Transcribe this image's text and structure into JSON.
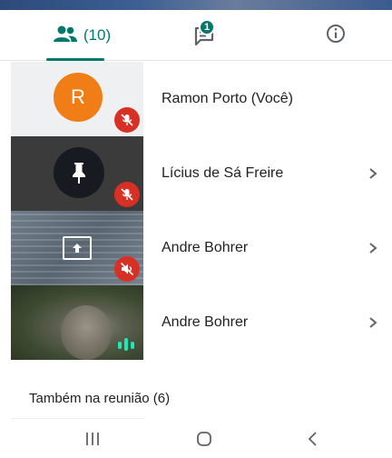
{
  "tabs": {
    "people": {
      "icon": "people-icon",
      "count": "(10)"
    },
    "chat": {
      "icon": "chat-icon",
      "badge": "1"
    },
    "info": {
      "icon": "info-icon"
    }
  },
  "colors": {
    "accent": "#00796b",
    "avatar_orange": "#f07d16",
    "mute_red": "#d93025",
    "audio_green": "#1de9b6"
  },
  "participants": [
    {
      "avatar_letter": "R",
      "name": "Ramon Porto (Você)",
      "status_icon": "mic-off-icon",
      "has_chevron": false
    },
    {
      "avatar_icon": "pin-icon",
      "name": "Lícius de Sá Freire",
      "status_icon": "mic-off-icon",
      "has_chevron": true
    },
    {
      "avatar_icon": "present-screen-icon",
      "name": "Andre Bohrer",
      "status_icon": "volume-off-icon",
      "has_chevron": true
    },
    {
      "avatar_icon": "video-feed",
      "name": "Andre Bohrer",
      "status_icon": "audio-level-icon",
      "has_chevron": true
    }
  ],
  "section": {
    "also_in_meeting": "Também na reunião (6)"
  },
  "navbar": {
    "recent": "recent-apps-icon",
    "home": "home-icon",
    "back": "back-icon"
  }
}
